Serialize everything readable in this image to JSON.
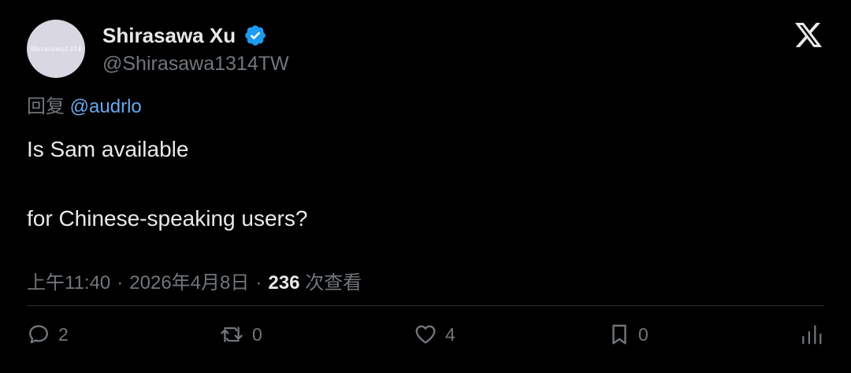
{
  "author": {
    "avatar_text": "Shirasawa1314",
    "name": "Shirasawa Xu",
    "handle": "@Shirasawa1314TW",
    "verified_icon": "verified-badge-icon",
    "verified_color": "#1d9bf0"
  },
  "platform_logo": "x-logo-icon",
  "reply": {
    "prefix": "回复",
    "mention": "@audrlo"
  },
  "tweet": {
    "line1": "Is Sam available",
    "line2": "for Chinese-speaking users?"
  },
  "meta": {
    "time": "上午11:40",
    "date": "2026年4月8日",
    "separator": "·",
    "views_count": "236",
    "views_label": "次查看"
  },
  "actions": {
    "replies": {
      "icon": "reply-icon",
      "count": "2"
    },
    "retweets": {
      "icon": "retweet-icon",
      "count": "0"
    },
    "likes": {
      "icon": "heart-icon",
      "count": "4"
    },
    "bookmarks": {
      "icon": "bookmark-icon",
      "count": "0"
    },
    "stats": {
      "icon": "stats-icon"
    }
  },
  "colors": {
    "background": "#000000",
    "primary_text": "#e7e9ea",
    "secondary_text": "#71767b",
    "mention": "#6aa8ec",
    "divider": "#2f3336"
  }
}
